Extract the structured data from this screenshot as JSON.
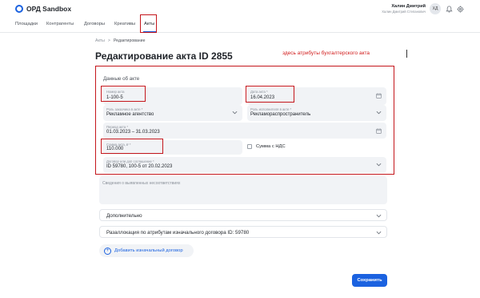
{
  "header": {
    "logo_text": "ОРД Sandbox",
    "user_name": "Халин Дмитрий",
    "user_full_name": "Халин Дмитрий Степанович",
    "avatar_initials": "ХД",
    "icons": [
      "bell-icon",
      "gear-icon"
    ]
  },
  "nav": {
    "items": [
      {
        "label": "Площадки",
        "active": false
      },
      {
        "label": "Контрагенты",
        "active": false
      },
      {
        "label": "Договоры",
        "active": false
      },
      {
        "label": "Креативы",
        "active": false
      },
      {
        "label": "Акты",
        "active": true
      }
    ]
  },
  "breadcrumb": {
    "root": "Акты",
    "separator": ">",
    "current": "Редактирование"
  },
  "page": {
    "title": "Редактирование акта ID 2855",
    "annotation": "здесь атрибуты бухгалтерского акта"
  },
  "form": {
    "section_title": "Данные об акте",
    "act_number": {
      "label": "Номер акта",
      "value": "1-100-5"
    },
    "act_date": {
      "label": "Дата акта *",
      "value": "16.04.2023"
    },
    "customer_role": {
      "label": "Роль заказчика в акте *",
      "value": "Рекламное агентство"
    },
    "performer_role": {
      "label": "Роль исполнителя в акте *",
      "value": "Рекламораспространитель"
    },
    "period": {
      "label": "Период акта *",
      "value": "01.03.2023 – 31.03.2023"
    },
    "amount": {
      "label": "Сумма акта, ₽ *",
      "value": "110.000"
    },
    "vat_checkbox_label": "Сумма с НДС",
    "vat_checked": false,
    "contract": {
      "label": "Договор или доп соглашение *",
      "value": "ID 59780, 100-5 от 20.02.2023"
    },
    "notes_placeholder": "Сведения о выявленных несоответствиях"
  },
  "sections": {
    "additional": "Дополнительно",
    "relocation": "Разаллокация по атрибутам изначального договора ID: 59780"
  },
  "buttons": {
    "add_contract": "Добавить изначальный договор",
    "save": "Сохранить"
  },
  "colors": {
    "accent": "#1b62e0",
    "highlight": "#c4161c",
    "field_bg": "#f1f3f6"
  }
}
